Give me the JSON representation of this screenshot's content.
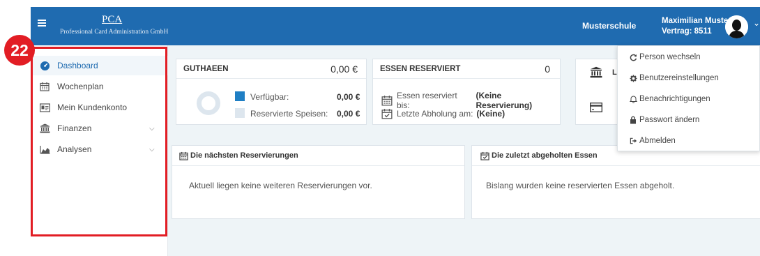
{
  "badge": {
    "number": "22"
  },
  "header": {
    "logo_title": "PCA",
    "logo_subtitle": "Professional Card Administration GmbH",
    "school_label": "Musterschule",
    "user_name": "Maximilian Muster",
    "user_contract": "Vertrag: 8511"
  },
  "sidebar": {
    "items": [
      {
        "label": "Dashboard",
        "icon": "dashboard-icon",
        "active": true
      },
      {
        "label": "Wochenplan",
        "icon": "calendar-icon"
      },
      {
        "label": "Mein Kundenkonto",
        "icon": "id-card-icon"
      },
      {
        "label": "Finanzen",
        "icon": "bank-icon",
        "expandable": true
      },
      {
        "label": "Analysen",
        "icon": "area-chart-icon",
        "expandable": true
      }
    ]
  },
  "guthaben": {
    "title": "GUTHAEEN",
    "amount": "0,00 €",
    "available_label": "Verfügbar:",
    "available_value": "0,00 €",
    "reserved_label": "Reservierte Speisen:",
    "reserved_value": "0,00 €",
    "available_color": "#1f7fc4",
    "reserved_color": "#dde6ee"
  },
  "essen": {
    "title": "ESSEN RESERVIERT",
    "count": "0",
    "reserved_until_label": "Essen reserviert bis:",
    "reserved_until_value": "(Keine Reservierung)",
    "last_pickup_label": "Letzte Abholung am:",
    "last_pickup_value": "(Keine)"
  },
  "third_card": {
    "title_partial": "Le"
  },
  "upcoming": {
    "title": "Die nächsten Reservierungen",
    "body": "Aktuell liegen keine weiteren Reservierungen vor."
  },
  "recent": {
    "title": "Die zuletzt abgeholten Essen",
    "body": "Bislang wurden keine reservierten Essen abgeholt."
  },
  "user_menu": {
    "items": [
      {
        "label": "Person wechseln",
        "icon": "refresh-icon"
      },
      {
        "label": "Benutzereinstellungen",
        "icon": "gear-icon"
      },
      {
        "label": "Benachrichtigungen",
        "icon": "bell-icon"
      },
      {
        "label": "Passwort ändern",
        "icon": "lock-icon"
      },
      {
        "label": "Abmelden",
        "icon": "logout-icon"
      }
    ]
  },
  "colors": {
    "header_bg": "#1f6bb0",
    "highlight_red": "#e21d24",
    "content_bg": "#eef4f7"
  }
}
